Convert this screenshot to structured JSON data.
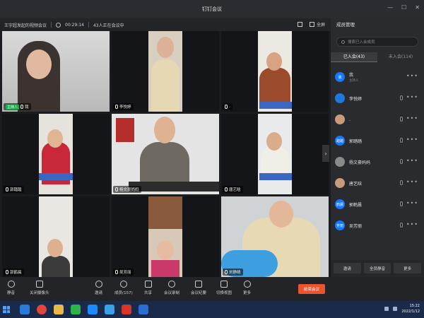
{
  "window": {
    "title": "钉钉会议"
  },
  "infobar": {
    "meeting_name": "王宇超发起的视频会议",
    "duration": "00:29:14",
    "in_meeting": "43人正在会议中",
    "fullscreen_label": "全屏"
  },
  "tiles": [
    {
      "name": "我",
      "host_badge": "主持人"
    },
    {
      "name": "李悦婷"
    },
    {
      "name": "."
    },
    {
      "name": "郭踏踏"
    },
    {
      "name": "杨文豪妈妈"
    },
    {
      "name": "唐艺晗"
    },
    {
      "name": "郭鹤晨"
    },
    {
      "name": "吴芳丽"
    },
    {
      "name": "刘静晴"
    }
  ],
  "panel": {
    "title": "成员管理",
    "search_placeholder": "搜索已入会成员",
    "tabs": [
      {
        "label": "已入会(43)"
      },
      {
        "label": "未入会(114)"
      }
    ],
    "members": [
      {
        "avatar": "我",
        "name": "我",
        "role": "主持人"
      },
      {
        "avatar": "",
        "name": "李悦婷",
        "role": ""
      },
      {
        "avatar": "",
        "name": ".",
        "role": ""
      },
      {
        "avatar": "踏踏",
        "name": "郭踏踏",
        "role": ""
      },
      {
        "avatar": "",
        "name": "杨文豪妈妈",
        "role": ""
      },
      {
        "avatar": "",
        "name": "唐艺晗",
        "role": ""
      },
      {
        "avatar": "鹤晨",
        "name": "郭鹤晨",
        "role": ""
      },
      {
        "avatar": "芳丽",
        "name": "吴芳丽",
        "role": ""
      }
    ],
    "footer": {
      "invite": "邀请",
      "mute_all": "全员静音",
      "more": "更多"
    }
  },
  "toolbar": {
    "mic": "静音",
    "camera": "关闭摄像头",
    "invite": "邀请",
    "members": "成员(157)",
    "share": "共享",
    "record": "会议录制",
    "minutes": "会议纪要",
    "switch_view": "切换视图",
    "more": "更多",
    "end": "结束会议"
  },
  "taskbar": {
    "time": "15:22",
    "date": "2022/1/12"
  },
  "colors": {
    "accent": "#1677ff",
    "end": "#e8552f",
    "host": "#1aad4d"
  }
}
